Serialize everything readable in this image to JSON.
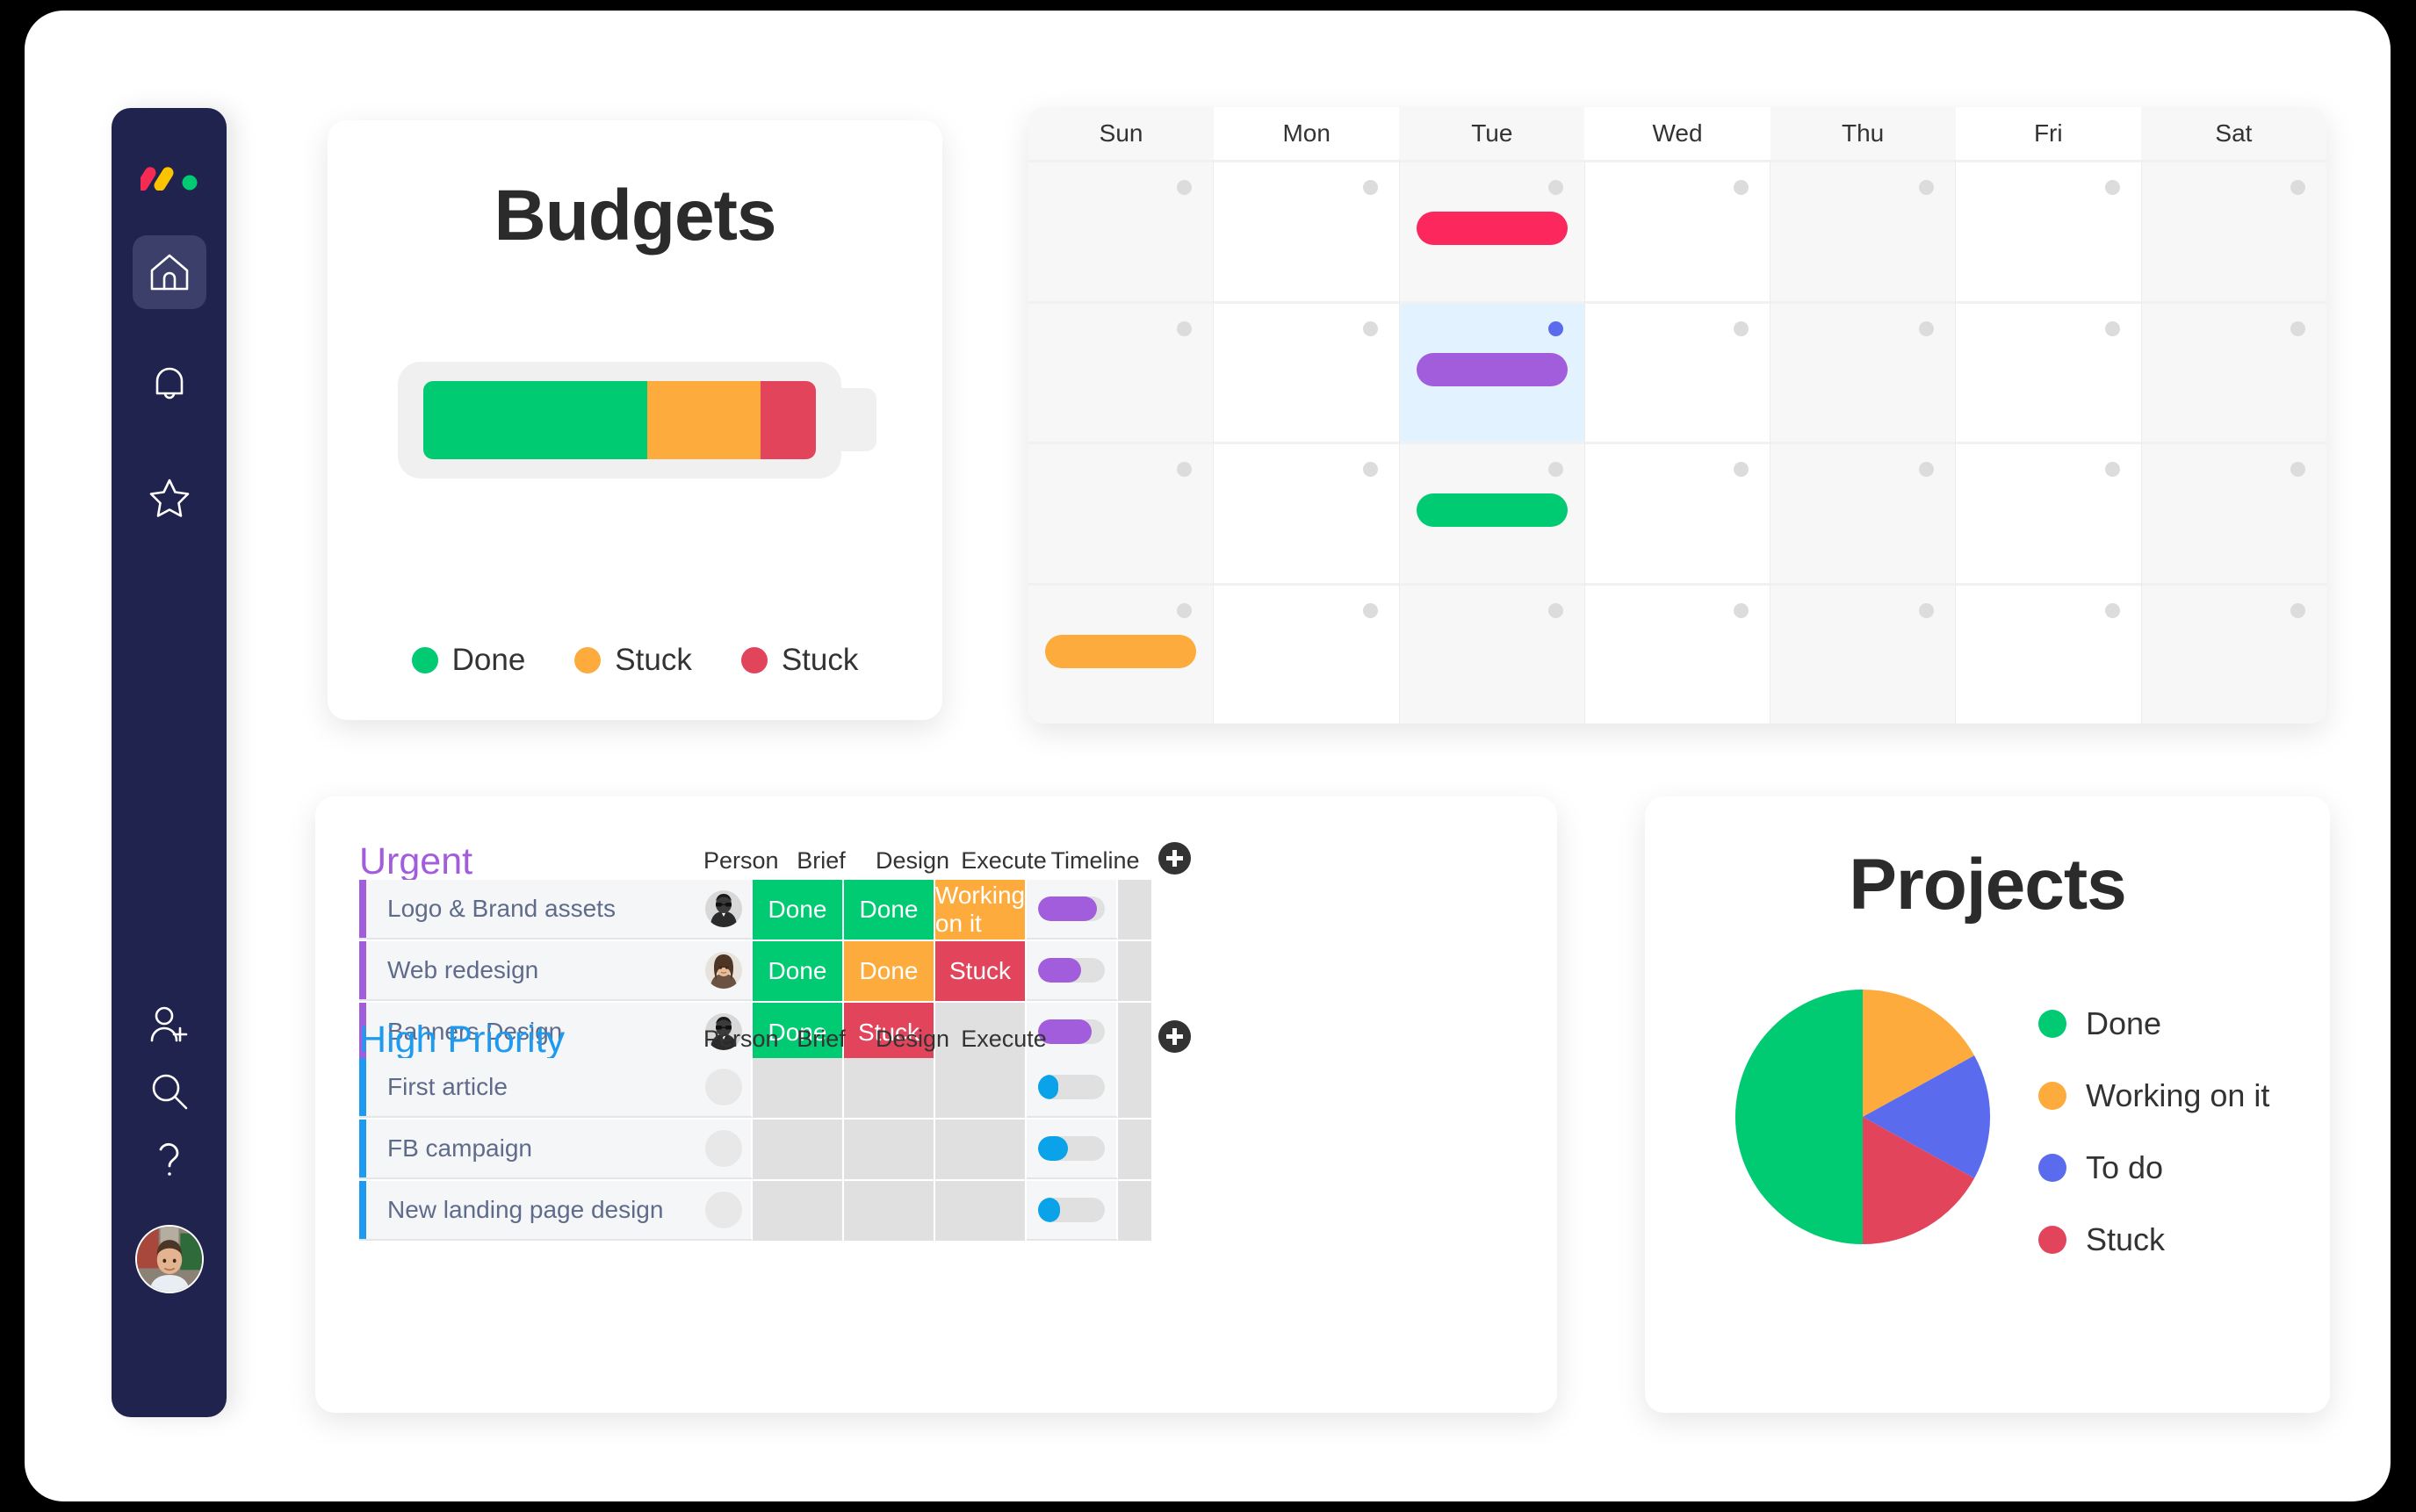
{
  "colors": {
    "green": "#00ca72",
    "orange": "#fdab3d",
    "red": "#e2445c",
    "pink": "#fb275d",
    "purple": "#a25ddc",
    "blue": "#579bfc",
    "light_blue": "#0aa2e8",
    "sidebar": "#20234e",
    "urgent_title": "#a25ddc",
    "high_priority_title": "#1e9bf0"
  },
  "sidebar": {
    "logo": "monday-logo",
    "items": [
      {
        "icon": "home-icon",
        "name": "home",
        "active": true
      },
      {
        "icon": "bell-icon",
        "name": "notifications",
        "active": false
      },
      {
        "icon": "star-icon",
        "name": "favorites",
        "active": false
      },
      {
        "icon": "add-user-icon",
        "name": "invite-members",
        "active": false
      },
      {
        "icon": "search-icon",
        "name": "search",
        "active": false
      },
      {
        "icon": "question-mark-icon",
        "name": "help",
        "active": false
      }
    ],
    "avatar": "user-avatar"
  },
  "budgets": {
    "title": "Budgets",
    "chart_data": {
      "type": "bar",
      "title": "Budgets",
      "categories": [
        "Done",
        "Stuck",
        "Stuck"
      ],
      "values": [
        57,
        29,
        14
      ],
      "colors": [
        "#00ca72",
        "#fdab3d",
        "#e2445c"
      ],
      "style": "stacked-battery",
      "ylabel": "",
      "xlabel": "",
      "legend_position": "bottom"
    },
    "legend": [
      {
        "label": "Done",
        "color": "#00ca72",
        "value": 57
      },
      {
        "label": "Stuck",
        "color": "#fdab3d",
        "value": 29
      },
      {
        "label": "Stuck",
        "color": "#e2445c",
        "value": 14
      }
    ]
  },
  "calendar": {
    "days": [
      "Sun",
      "Mon",
      "Tue",
      "Wed",
      "Thu",
      "Fri",
      "Sat"
    ],
    "rows": 4,
    "events": [
      {
        "row": 0,
        "day": 2,
        "color": "#fb275d",
        "name": "event-pink"
      },
      {
        "row": 1,
        "day": 2,
        "color": "#a25ddc",
        "name": "event-purple"
      },
      {
        "row": 2,
        "day": 2,
        "color": "#00ca72",
        "name": "event-green"
      },
      {
        "row": 3,
        "day": 0,
        "color": "#fdab3d",
        "name": "event-orange"
      }
    ],
    "selected_cell": {
      "row": 1,
      "day": 2
    },
    "selected_dot_color": "#5a6ced"
  },
  "board": {
    "add_column_label": "+",
    "groups": [
      {
        "title": "Urgent",
        "color": "#a25ddc",
        "columns": [
          "Person",
          "Brief",
          "Design",
          "Execute",
          "Timeline"
        ],
        "rows": [
          {
            "name": "Logo & Brand assets",
            "person": "avatar-male",
            "brief": {
              "label": "Done",
              "color": "#00ca72"
            },
            "design": {
              "label": "Done",
              "color": "#00ca72"
            },
            "execute": {
              "label": "Working on it",
              "color": "#fdab3d"
            },
            "timeline": 88,
            "timeline_color": "#a25ddc"
          },
          {
            "name": "Web redesign",
            "person": "avatar-female",
            "brief": {
              "label": "Done",
              "color": "#00ca72"
            },
            "design": {
              "label": "Done",
              "color": "#fdab3d"
            },
            "execute": {
              "label": "Stuck",
              "color": "#e2445c"
            },
            "timeline": 65,
            "timeline_color": "#a25ddc"
          },
          {
            "name": "Banners Design",
            "person": "avatar-male",
            "brief": {
              "label": "Done",
              "color": "#00ca72"
            },
            "design": {
              "label": "Stuck",
              "color": "#e2445c"
            },
            "execute": {
              "label": "",
              "color": "#e0e0e0"
            },
            "timeline": 80,
            "timeline_color": "#a25ddc"
          }
        ]
      },
      {
        "title": "High Priority",
        "color": "#1e9bf0",
        "columns": [
          "Person",
          "Brief",
          "Design",
          "Execute"
        ],
        "rows": [
          {
            "name": "First article",
            "person": "",
            "brief": {
              "label": "",
              "color": "#e0e0e0"
            },
            "design": {
              "label": "",
              "color": "#e0e0e0"
            },
            "execute": {
              "label": "",
              "color": "#e0e0e0"
            },
            "timeline": 30,
            "timeline_color": "#0aa2e8"
          },
          {
            "name": "FB campaign",
            "person": "",
            "brief": {
              "label": "",
              "color": "#e0e0e0"
            },
            "design": {
              "label": "",
              "color": "#e0e0e0"
            },
            "execute": {
              "label": "",
              "color": "#e0e0e0"
            },
            "timeline": 45,
            "timeline_color": "#0aa2e8"
          },
          {
            "name": "New landing page design",
            "person": "",
            "brief": {
              "label": "",
              "color": "#e0e0e0"
            },
            "design": {
              "label": "",
              "color": "#e0e0e0"
            },
            "execute": {
              "label": "",
              "color": "#e0e0e0"
            },
            "timeline": 33,
            "timeline_color": "#0aa2e8"
          }
        ]
      }
    ]
  },
  "projects": {
    "title": "Projects",
    "chart_data": {
      "type": "pie",
      "title": "Projects",
      "categories": [
        "Done",
        "Working on it",
        "To do",
        "Stuck"
      ],
      "values": [
        50,
        17,
        16,
        17
      ],
      "colors": [
        "#00ca72",
        "#fdab3d",
        "#5a6ced",
        "#e2445c"
      ],
      "legend_position": "right",
      "start_angle": 0
    },
    "legend": [
      {
        "label": "Done",
        "color": "#00ca72",
        "value": 50
      },
      {
        "label": "Working on it",
        "color": "#fdab3d",
        "value": 17
      },
      {
        "label": "To do",
        "color": "#5a6ced",
        "value": 16
      },
      {
        "label": "Stuck",
        "color": "#e2445c",
        "value": 17
      }
    ]
  }
}
